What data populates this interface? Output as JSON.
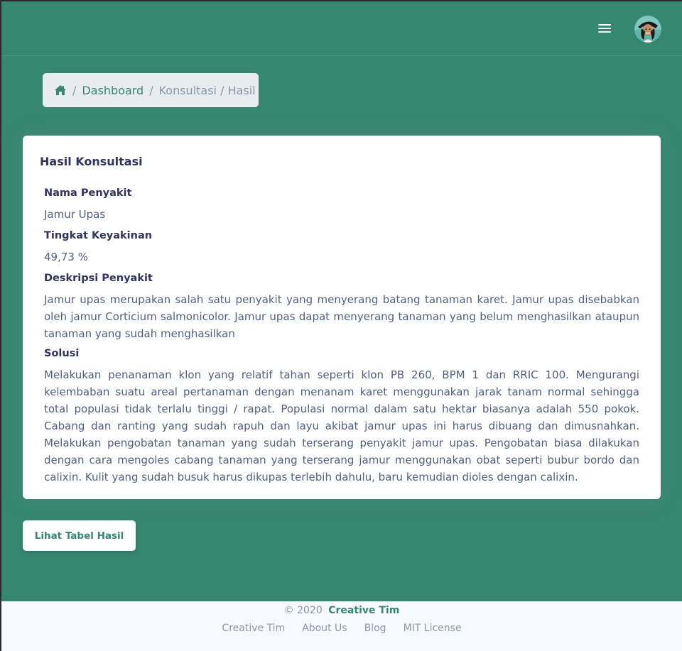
{
  "header": {
    "menu_icon": "hamburger-menu-icon",
    "avatar_icon": "user-avatar"
  },
  "breadcrumb": {
    "home_icon": "home-icon",
    "separator": "/",
    "dashboard": "Dashboard",
    "current": "Konsultasi / Hasil"
  },
  "card": {
    "title": "Hasil Konsultasi",
    "nama_label": "Nama Penyakit",
    "nama_value": "Jamur Upas",
    "tingkat_label": "Tingkat Keyakinan",
    "tingkat_value": "49,73 %",
    "deskripsi_label": "Deskripsi Penyakit",
    "deskripsi_value": "Jamur upas merupakan salah satu penyakit yang menyerang batang tanaman karet. Jamur upas disebabkan oleh jamur Corticium salmonicolor. Jamur upas dapat menyerang tanaman yang belum menghasilkan ataupun tanaman yang sudah menghasilkan",
    "solusi_label": "Solusi",
    "solusi_value": "Melakukan penanaman klon yang relatif tahan seperti klon PB 260, BPM 1 dan RRIC 100. Mengurangi kelembaban suatu areal pertanaman dengan menanam karet menggunakan jarak tanam normal sehingga total populasi tidak terlalu tinggi / rapat. Populasi normal dalam satu hektar biasanya adalah 550 pokok. Cabang dan ranting yang sudah rapuh dan layu akibat jamur upas ini harus dibuang dan dimusnahkan. Melakukan pengobatan tanaman yang sudah terserang penyakit jamur upas. Pengobatan biasa dilakukan dengan cara mengoles cabang tanaman yang terserang jamur menggunakan obat seperti bubur bordo dan calixin. Kulit yang sudah busuk harus dikupas terlebih dahulu, baru kemudian dioles dengan calixin."
  },
  "actions": {
    "lihat_tabel": "Lihat Tabel Hasil"
  },
  "footer": {
    "copyright": "© 2020",
    "brand": "Creative Tim",
    "links": [
      "Creative Tim",
      "About Us",
      "Blog",
      "MIT License"
    ]
  },
  "colors": {
    "primary": "#36876f",
    "hero_bg": "#36876f",
    "heading": "#32325d",
    "text": "#525f7f",
    "muted": "#8898aa"
  }
}
